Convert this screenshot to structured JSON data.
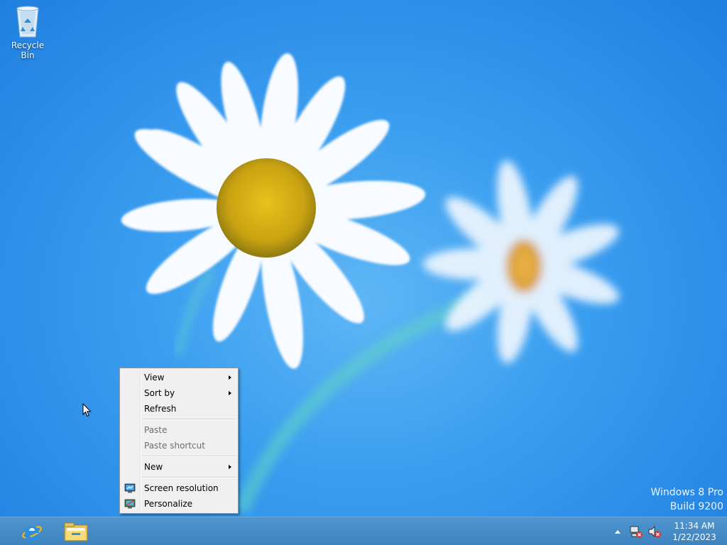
{
  "desktop": {
    "icons": [
      {
        "label": "Recycle Bin",
        "icon": "recycle-bin-icon"
      }
    ],
    "watermark": {
      "line1": "Windows 8 Pro",
      "line2": "Build 9200"
    }
  },
  "context_menu": {
    "items": {
      "view": "View",
      "sort_by": "Sort by",
      "refresh": "Refresh",
      "paste": "Paste",
      "paste_shortcut": "Paste shortcut",
      "new": "New",
      "screen_resolution": "Screen resolution",
      "personalize": "Personalize"
    }
  },
  "taskbar": {
    "pinned": [
      {
        "name": "Internet Explorer",
        "icon": "internet-explorer-icon"
      },
      {
        "name": "File Explorer",
        "icon": "file-explorer-icon"
      }
    ],
    "tray": {
      "icons": [
        "show-hidden-icons-chevron",
        "network-error-icon",
        "volume-muted-icon"
      ],
      "time": "11:34 AM",
      "date": "1/22/2023"
    }
  },
  "colors": {
    "wallpaper_blue": "#3b9ff0",
    "taskbar": "#4089c6",
    "menu_bg": "#f0f0f0"
  }
}
